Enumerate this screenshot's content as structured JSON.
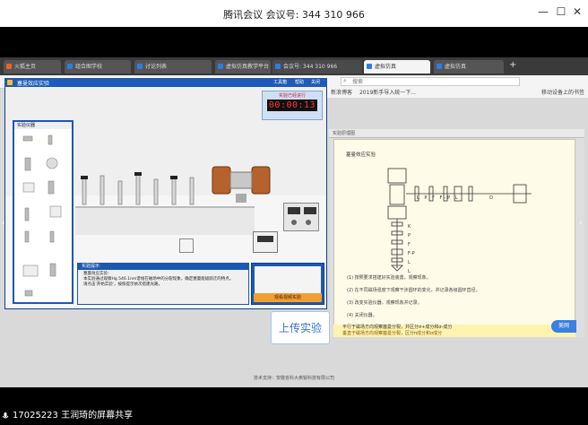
{
  "meeting": {
    "title": "腾讯会议  会议号: 344 310 966",
    "window_controls": [
      "—",
      "☐",
      "✕"
    ]
  },
  "browser": {
    "tabs": [
      {
        "label": "火狐主页",
        "color": "#e8632a"
      },
      {
        "label": "组合图学校",
        "color": "#2a7de8"
      },
      {
        "label": "讨论列表",
        "color": "#2a7de8"
      },
      {
        "label": "虚拟仿真教学平台",
        "color": "#2a7de8"
      },
      {
        "label": "会议号: 344 310 966",
        "color": "#2a7de8"
      },
      {
        "label": "虚拟仿真",
        "color": "#2a7de8"
      },
      {
        "label": "虚拟仿真",
        "color": "#2a7de8"
      }
    ],
    "url_placeholder": "搜索",
    "bookmarks": [
      "新浪博客",
      "2019新手导入统一下..."
    ],
    "right_bookmark": "移动设备上的书签"
  },
  "sim": {
    "title": "塞曼效应实验",
    "menu": [
      "工具箱",
      "帮助",
      "关闭"
    ],
    "timer_label": "实验已经进行",
    "timer_value": "00:00:13",
    "palette_title": "实验仪器",
    "dialog_title": "实验提示",
    "dialog_lines": [
      "塞曼效应实验：",
      "本实验通过观察Hg 546.1nm谱线在磁场中的分裂现象，确定塞曼能级跃迁的特点。",
      "请点击'开始实验'，按照提示依次搭建光路。"
    ],
    "start_button": "观看视频实验"
  },
  "doc": {
    "bar_label": "实验原理图",
    "heading": "塞曼效应实验",
    "labels": {
      "row1": [
        "L",
        "P",
        "F",
        "F-P",
        "L",
        "D"
      ],
      "col": [
        "K",
        "P",
        "F",
        "F-P",
        "L",
        "L"
      ]
    },
    "lines": [
      "(1) 按照要求搭建好实验装置，观察现象。",
      "(2) 在不同磁场强度下观察干涉圆环的变化，并记录各级圆环直径。",
      "(3) 改变实验仪器，观察现象并记录。",
      "(4) 关闭仪器。"
    ],
    "highlight": [
      "平行于磁场方向观察塞曼分裂，并区分σ+成分和σ-成分",
      "垂直于磁场方向观察塞曼分裂，区分π成分和σ成分"
    ],
    "share_label": "美网"
  },
  "page": {
    "upload_label": "上传实验",
    "footer": "技术支持：安徽省科大奥锐科技有限公司"
  },
  "status": {
    "text": "17025223 王润琦的屏幕共享"
  },
  "colors": {
    "sim_frame": "#1e5bb8",
    "accent_button": "#f0a030",
    "doc_bg": "#fefbe8"
  }
}
